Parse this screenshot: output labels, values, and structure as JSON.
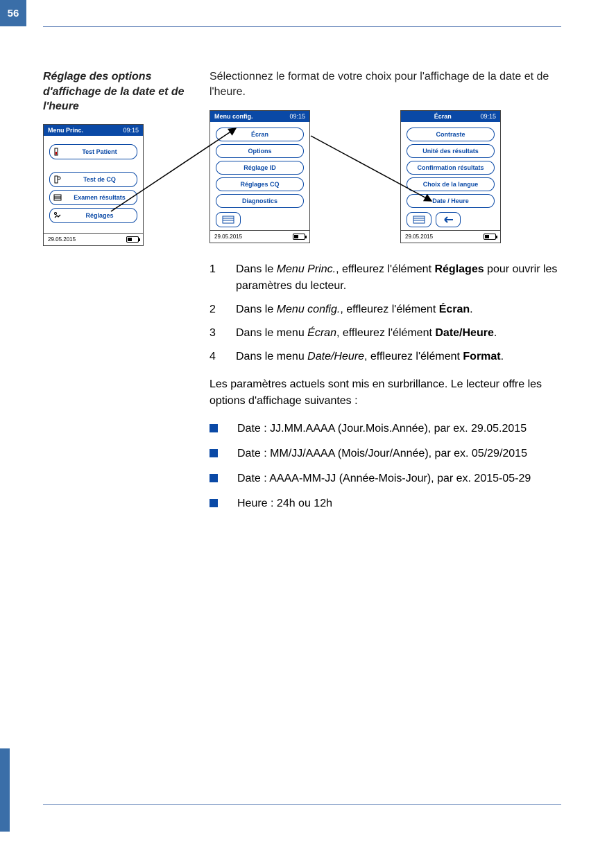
{
  "page": {
    "number": "56"
  },
  "section_title": "Réglage des options d'affichage de la date et de l'heure",
  "intro": "Sélectionnez le format de votre choix pour l'affichage de la date et de l'heure.",
  "device1": {
    "title": "Menu Princ.",
    "time": "09:15",
    "items": [
      {
        "label": "Test Patient",
        "icon": "test-patient-icon"
      },
      {
        "label": "Test de CQ",
        "icon": "test-cq-icon"
      },
      {
        "label": "Examen résultats",
        "icon": "results-icon"
      },
      {
        "label": "Réglages",
        "icon": "settings-icon"
      }
    ],
    "date": "29.05.2015"
  },
  "device2": {
    "title": "Menu config.",
    "time": "09:15",
    "items": [
      {
        "label": "Écran"
      },
      {
        "label": "Options"
      },
      {
        "label": "Réglage ID"
      },
      {
        "label": "Réglages CQ"
      },
      {
        "label": "Diagnostics"
      }
    ],
    "date": "29.05.2015"
  },
  "device3": {
    "title": "Écran",
    "time": "09:15",
    "items": [
      {
        "label": "Contraste"
      },
      {
        "label": "Unité des résultats"
      },
      {
        "label": "Confirmation résultats"
      },
      {
        "label": "Choix de la langue"
      },
      {
        "label": "Date / Heure"
      }
    ],
    "date": "29.05.2015"
  },
  "steps": [
    {
      "n": "1",
      "pre": "Dans le ",
      "em": "Menu Princ.",
      "mid": ", effleurez l'élément ",
      "strong": "Réglages",
      "post": " pour ouvrir les paramètres du lecteur."
    },
    {
      "n": "2",
      "pre": "Dans le ",
      "em": "Menu config.",
      "mid": ", effleurez l'élément ",
      "strong": "Écran",
      "post": "."
    },
    {
      "n": "3",
      "pre": "Dans le menu ",
      "em": "Écran",
      "mid": ", effleurez l'élément ",
      "strong": "Date/Heure",
      "post": "."
    },
    {
      "n": "4",
      "pre": "Dans le menu ",
      "em": "Date/Heure",
      "mid": ", effleurez l'élément ",
      "strong": "Format",
      "post": "."
    }
  ],
  "para1": "Les paramètres actuels sont mis en surbrillance. Le lecteur offre les options d'affichage suivantes :",
  "bullets": [
    "Date : JJ.MM.AAAA (Jour.Mois.Année), par ex. 29.05.2015",
    "Date : MM/JJ/AAAA (Mois/Jour/Année), par ex. 05/29/2015",
    "Date : AAAA-MM-JJ (Année-Mois-Jour), par ex. 2015-05-29",
    "Heure : 24h ou 12h"
  ]
}
